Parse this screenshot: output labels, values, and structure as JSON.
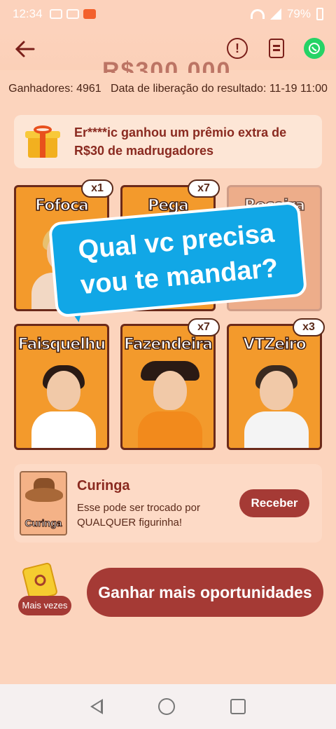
{
  "status_bar": {
    "time": "12:34",
    "battery": "79%"
  },
  "header": {
    "prize_amount": "R$300.000"
  },
  "meta": {
    "winners_label": "Ganhadores: 4961",
    "release_label": "Data de liberação do resultado: 11-19 11:00"
  },
  "notice": {
    "line1": "Er****ic ganhou um prêmio extra de",
    "line2": "R$30 de madrugadores"
  },
  "cards": [
    {
      "title": "Fofoca",
      "count": "x1"
    },
    {
      "title": "Pega",
      "count": "x7"
    },
    {
      "title": "Roceira",
      "count": ""
    },
    {
      "title": "Faisquelhu",
      "count": ""
    },
    {
      "title": "Fazendeira",
      "count": "x7"
    },
    {
      "title": "VTZeiro",
      "count": "x3"
    }
  ],
  "overlay": {
    "line1": "Qual vc precisa",
    "line2": "vou te mandar?"
  },
  "wildcard": {
    "image_label": "Curinga",
    "title": "Curinga",
    "description": "Esse pode ser trocado por QUALQUER figurinha!",
    "button": "Receber"
  },
  "more_times": {
    "label": "Mais vezes"
  },
  "opportunities_button": "Ganhar mais oportunidades",
  "colors": {
    "accent": "#a53a35",
    "background": "#fcd4bd",
    "card": "#f39a2c",
    "bubble": "#11a7e6"
  }
}
